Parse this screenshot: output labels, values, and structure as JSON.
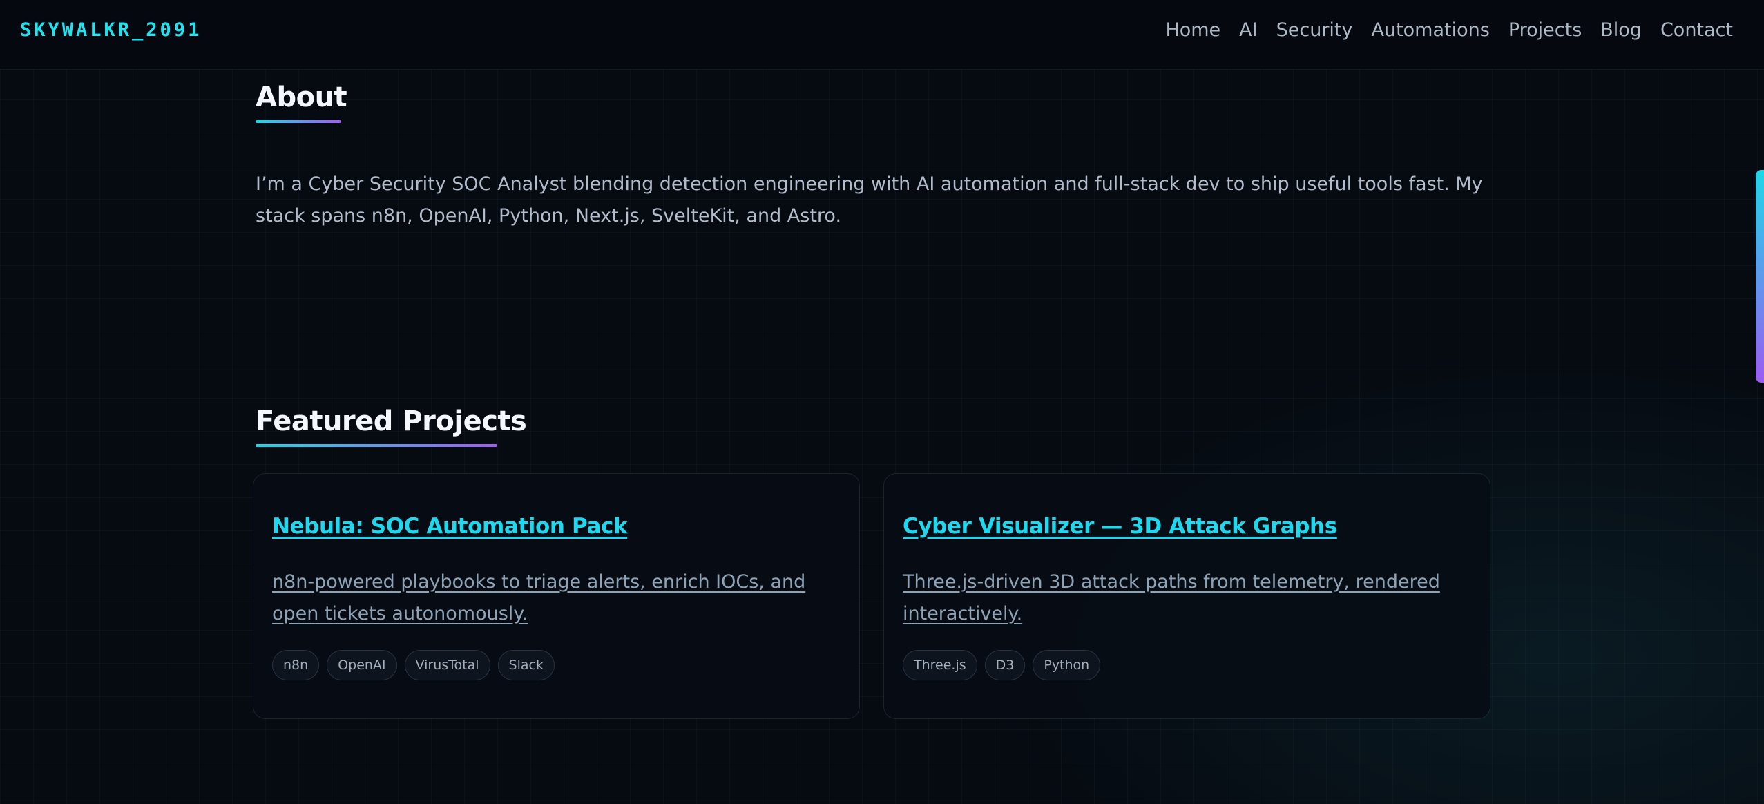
{
  "header": {
    "brand": "SKYWALKR_2091",
    "nav": [
      "Home",
      "AI",
      "Security",
      "Automations",
      "Projects",
      "Blog",
      "Contact"
    ]
  },
  "about": {
    "title": "About",
    "text": "I’m a Cyber Security SOC Analyst blending detection engineering with AI automation and full-stack dev to ship useful tools fast. My stack spans n8n, OpenAI, Python, Next.js, SvelteKit, and Astro."
  },
  "projects": {
    "title": "Featured Projects",
    "items": [
      {
        "title": "Nebula: SOC Automation Pack",
        "description": "n8n-powered playbooks to triage alerts, enrich IOCs, and open tickets autonomously.",
        "tags": [
          "n8n",
          "OpenAI",
          "VirusTotal",
          "Slack"
        ]
      },
      {
        "title": "Cyber Visualizer — 3D Attack Graphs",
        "description": "Three.js-driven 3D attack paths from telemetry, rendered interactively.",
        "tags": [
          "Three.js",
          "D3",
          "Python"
        ]
      }
    ]
  },
  "colors": {
    "accent_cyan": "#1fe3ee",
    "accent_purple": "#a05cf0",
    "background": "#060a11"
  }
}
